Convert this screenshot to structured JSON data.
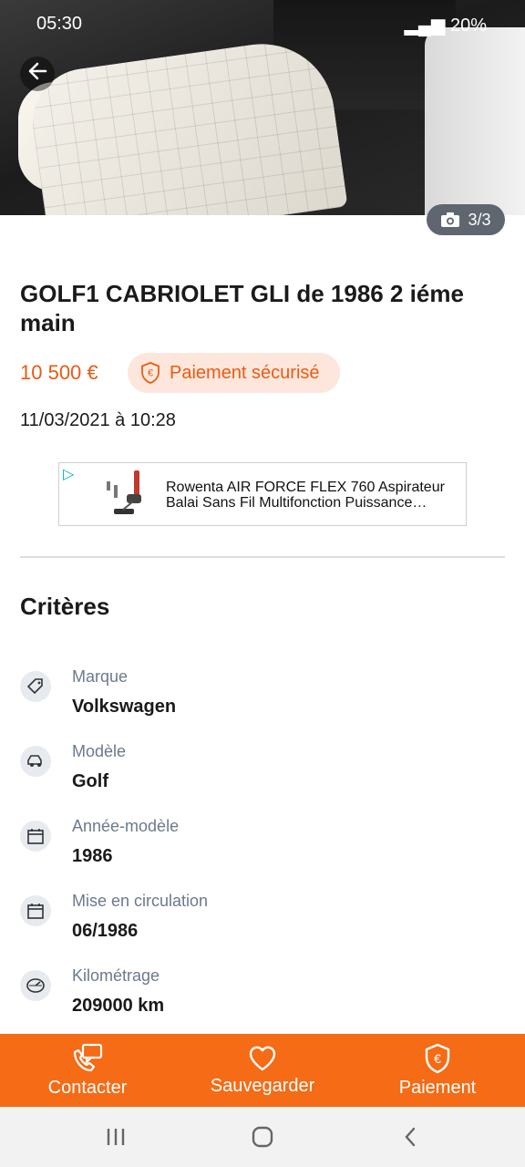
{
  "status_bar": {
    "time": "05:30",
    "battery": "20%"
  },
  "photo": {
    "counter": "3/3"
  },
  "listing": {
    "title": "GOLF1 CABRIOLET GLI de 1986 2 iéme main",
    "price": "10 500 €",
    "payment_badge": "Paiement sécurisé",
    "date": "11/03/2021 à 10:28"
  },
  "ad": {
    "text_line1": "Rowenta AIR FORCE FLEX 760 Aspirateur",
    "text_line2": "Balai Sans Fil Multifonction Puissance…"
  },
  "criteria": {
    "title": "Critères",
    "items": [
      {
        "label": "Marque",
        "value": "Volkswagen",
        "icon": "tag-icon"
      },
      {
        "label": "Modèle",
        "value": "Golf",
        "icon": "car-icon"
      },
      {
        "label": "Année-modèle",
        "value": "1986",
        "icon": "calendar-icon"
      },
      {
        "label": "Mise en circulation",
        "value": "06/1986",
        "icon": "calendar-icon"
      },
      {
        "label": "Kilométrage",
        "value": "209000 km",
        "icon": "speedometer-icon"
      }
    ]
  },
  "actions": {
    "contact": "Contacter",
    "save": "Sauvegarder",
    "pay": "Paiement"
  },
  "colors": {
    "accent": "#f56b16",
    "price": "#ec5a13",
    "badge_bg": "#fde7dc"
  }
}
